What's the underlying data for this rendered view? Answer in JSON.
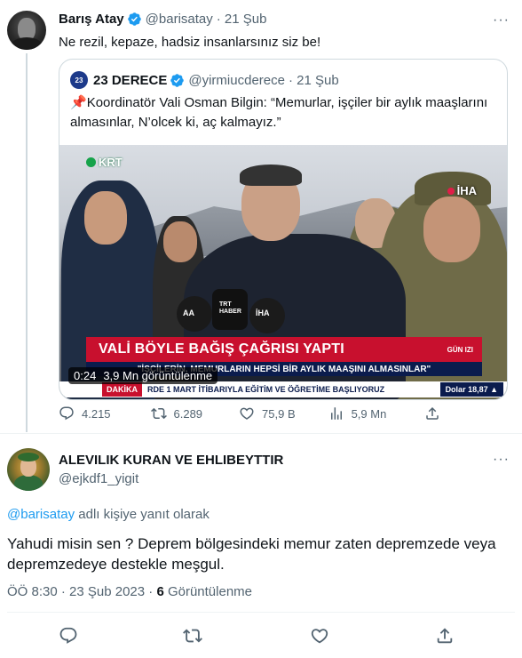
{
  "tweet": {
    "author_name": "Barış Atay",
    "handle": "@barisatay",
    "time": "· 21 Şub",
    "text": "Ne rezil, kepaze, hadsiz insanlarsınız siz be!",
    "more_label": "···",
    "quote": {
      "author_name": "23 DERECE",
      "avatar_text": "23",
      "handle": "@yirmiucderece",
      "time": "· 21 Şub",
      "pin": "📌",
      "text": "Koordinatör Vali Osman Bilgin: “Memurlar, işçiler bir aylık maaşlarını almasınlar, N’olcek ki, aç kalmayız.”",
      "video": {
        "channel_logo": "KRT",
        "agency_logo": "İHA",
        "mic_labels": [
          "AA",
          "TRT HABER",
          "İHA"
        ],
        "headline": "VALİ BÖYLE BAĞIŞ ÇAĞRISI YAPTI",
        "headline_tag": "GÜN IZI",
        "subheadline": "\"İŞÇİLERİN, MEMURLARIN HEPSİ BİR AYLIK MAAŞINI ALMASINLAR\"",
        "ticker_label": "DAKİKA",
        "ticker_text": "RDE 1 MART İTİBARIYLA EĞİTİM VE ÖĞRETİME BAŞLIYORUZ",
        "dolar": "Dolar  18,87 ▲",
        "duration": "0:24",
        "views": "3,9 Mn görüntülenme"
      }
    },
    "actions": {
      "replies": "4.215",
      "retweets": "6.289",
      "likes": "75,9 B",
      "views": "5,9 Mn"
    }
  },
  "reply": {
    "author_name": "ALEVILIK KURAN VE EHLIBEYTTIR",
    "handle": "@ejkdf1_yigit",
    "more_label": "···",
    "replying_mention": "@barisatay",
    "replying_suffix": " adlı kişiye yanıt olarak",
    "text": "Yahudi misin sen ? Deprem bölgesindeki memur zaten depremzede veya depremzedeye destekle meşgul.",
    "timestamp": "ÖÖ 8:30 · 23 Şub 2023 · ",
    "view_count": "6",
    "view_label": " Görüntülenme"
  },
  "colors": {
    "accent": "#1d9bf0",
    "muted": "#536471",
    "news_red": "#c8102e",
    "news_navy": "#0b1c4d"
  }
}
